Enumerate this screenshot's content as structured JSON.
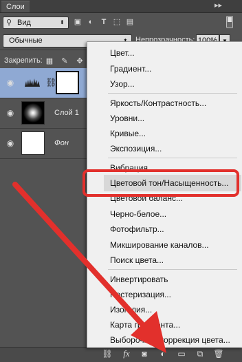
{
  "panel": {
    "tab_label": "Слои",
    "collapse_glyph": "▸▸",
    "menu_glyph": "≡"
  },
  "filter": {
    "kind_value": "Вид",
    "kind_icon": "search-icon"
  },
  "blend": {
    "mode_value": "Обычные",
    "opacity_label": "Непрозрачность:",
    "opacity_value": "100%"
  },
  "lock": {
    "label": "Закрепить:"
  },
  "layers": [
    {
      "name": "",
      "type": "adjustment-levels",
      "selected": true
    },
    {
      "name": "Слой 1",
      "type": "pixel-radial",
      "selected": false
    },
    {
      "name": "Фон",
      "type": "background",
      "selected": false
    }
  ],
  "menu": {
    "items": [
      "Цвет...",
      "Градиент...",
      "Узор...",
      "Яркость/Контрастность...",
      "Уровни...",
      "Кривые...",
      "Экспозиция...",
      "Вибрация...",
      "Цветовой тон/Насыщенность...",
      "Цветовой баланс...",
      "Черно-белое...",
      "Фотофильтр...",
      "Микширование каналов...",
      "Поиск цвета...",
      "Инвертировать",
      "Постеризация...",
      "Изогелия...",
      "Карта градиента...",
      "Выборочная коррекция цвета..."
    ],
    "highlighted": "Цветовой тон/Насыщенность..."
  },
  "toolbar": {
    "fx_label": "fx"
  },
  "colors": {
    "highlight_box": "#e2302c",
    "arrow": "#e2302c",
    "selected_layer": "#8fa9d3"
  }
}
